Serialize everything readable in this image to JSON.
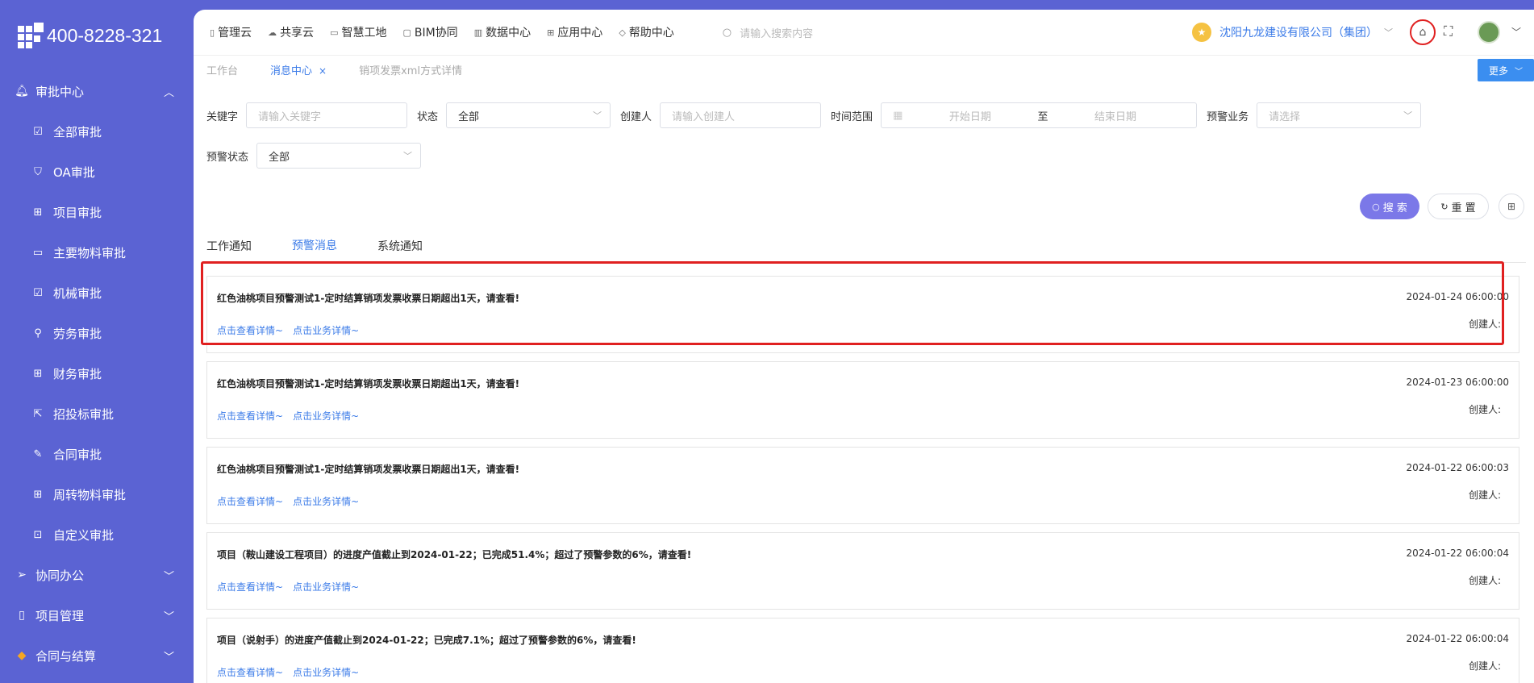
{
  "logo": {
    "phone": "400-8228-321"
  },
  "sidebar": {
    "approval_center": "审批中心",
    "items": [
      {
        "label": "全部审批",
        "icon": "checkbox-icon"
      },
      {
        "label": "OA审批",
        "icon": "shield-check-icon"
      },
      {
        "label": "项目审批",
        "icon": "grid-icon"
      },
      {
        "label": "主要物料审批",
        "icon": "chat-icon"
      },
      {
        "label": "机械审批",
        "icon": "checkbox-icon"
      },
      {
        "label": "劳务审批",
        "icon": "user-icon"
      },
      {
        "label": "财务审批",
        "icon": "grid-icon"
      },
      {
        "label": "招投标审批",
        "icon": "share-icon"
      },
      {
        "label": "合同审批",
        "icon": "edit-doc-icon"
      },
      {
        "label": "周转物料审批",
        "icon": "grid-icon"
      },
      {
        "label": "自定义审批",
        "icon": "custom-icon"
      }
    ],
    "groups": [
      {
        "label": "协同办公"
      },
      {
        "label": "项目管理"
      },
      {
        "label": "合同与结算"
      }
    ]
  },
  "topnav": {
    "items": [
      "管理云",
      "共享云",
      "智慧工地",
      "BIM协同",
      "数据中心",
      "应用中心",
      "帮助中心"
    ],
    "search_placeholder": "请输入搜索内容",
    "company": "沈阳九龙建设有限公司（集团）"
  },
  "pagetabs": {
    "workbench": "工作台",
    "message_center": "消息中心",
    "detail": "销项发票xml方式详情",
    "more": "更多"
  },
  "filters": {
    "keyword_label": "关键字",
    "keyword_placeholder": "请输入关键字",
    "status_label": "状态",
    "status_value": "全部",
    "creator_label": "创建人",
    "creator_placeholder": "请输入创建人",
    "time_label": "时间范围",
    "start_placeholder": "开始日期",
    "to": "至",
    "end_placeholder": "结束日期",
    "warning_business_label": "预警业务",
    "warning_business_placeholder": "请选择",
    "warning_status_label": "预警状态",
    "warning_status_value": "全部",
    "search": "搜 索",
    "reset": "重 置"
  },
  "message_tabs": [
    "工作通知",
    "预警消息",
    "系统通知"
  ],
  "messages": [
    {
      "title": "红色油桃项目预警测试1-定时结算销项发票收票日期超出1天，请查看!",
      "time": "2024-01-24 06:00:00",
      "creator": "创建人:",
      "view": "点击查看详情~",
      "business": "点击业务详情~"
    },
    {
      "title": "红色油桃项目预警测试1-定时结算销项发票收票日期超出1天，请查看!",
      "time": "2024-01-23 06:00:00",
      "creator": "创建人:",
      "view": "点击查看详情~",
      "business": "点击业务详情~"
    },
    {
      "title": "红色油桃项目预警测试1-定时结算销项发票收票日期超出1天，请查看!",
      "time": "2024-01-22 06:00:03",
      "creator": "创建人:",
      "view": "点击查看详情~",
      "business": "点击业务详情~"
    },
    {
      "title": "项目（鞍山建设工程项目）的进度产值截止到2024-01-22；已完成51.4%；超过了预警参数的6%，请查看!",
      "time": "2024-01-22 06:00:04",
      "creator": "创建人:",
      "view": "点击查看详情~",
      "business": "点击业务详情~"
    },
    {
      "title": "项目（说射手）的进度产值截止到2024-01-22；已完成7.1%；超过了预警参数的6%，请查看!",
      "time": "2024-01-22 06:00:04",
      "creator": "创建人:",
      "view": "点击查看详情~",
      "business": "点击业务详情~"
    }
  ]
}
